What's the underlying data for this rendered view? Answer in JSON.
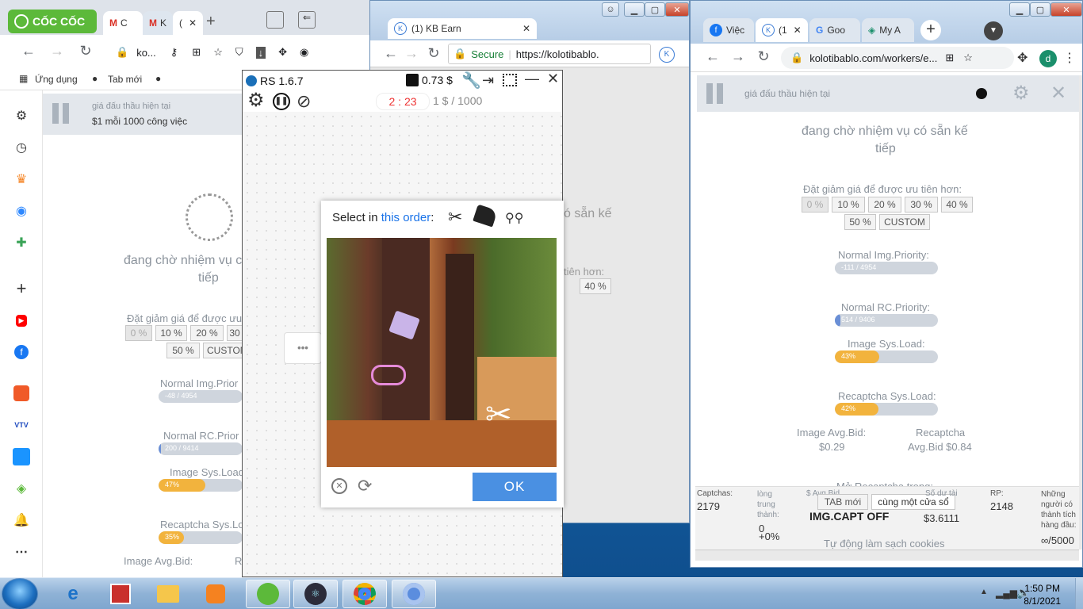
{
  "left_browser": {
    "brand": "CỐC CỐC",
    "tabs": [
      {
        "label": "C"
      },
      {
        "label": "K"
      },
      {
        "label": "("
      }
    ],
    "address": "ko...",
    "bookmarks": [
      {
        "label": "Ứng dụng"
      },
      {
        "label": "Tab mới"
      }
    ],
    "kb": {
      "bid_label": "giá đấu thầu hiện tại",
      "bid_value": "$1 mỗi 1000 công việc",
      "waiting": "đang chờ nhiệm vụ c",
      "waiting2": "tiếp",
      "discount_label": "Đặt giảm giá để được ưu",
      "discounts": [
        "0 %",
        "10 %",
        "20 %",
        "30",
        "50 %",
        "CUSTOM"
      ],
      "bars": [
        {
          "title": "Normal Img.Prior",
          "label": "-48 / 4954",
          "fill": 0.01,
          "color": "#cfd5dd"
        },
        {
          "title": "Normal RC.Prior",
          "label": "200 / 9414",
          "fill": 0.02,
          "color": "#6a8fd6"
        },
        {
          "title": "Image Sys.Load",
          "label": "47%",
          "fill": 0.47,
          "color": "#f2b33d"
        },
        {
          "title": "Recaptcha Sys.Lo",
          "label": "35%",
          "fill": 0.35,
          "color": "#f2b33d"
        }
      ],
      "avg_bid": "Image Avg.Bid:",
      "avg_bid2": "R"
    }
  },
  "middle_browser": {
    "tab": "(1) KB Earn",
    "secure": "Secure",
    "url": "https://kolotibablo.",
    "partial_waiting": "ó sẵn kế",
    "partial_discount": "tiên hơn:",
    "partial_pct": "40 %"
  },
  "right_browser": {
    "tabs": [
      {
        "label": "Việc"
      },
      {
        "label": "(1"
      },
      {
        "label": "Goo"
      },
      {
        "label": "My A"
      }
    ],
    "url": "kolotibablo.com/workers/e...",
    "avatar": "d",
    "kb": {
      "bid_label": "giá đấu thầu hiện tại",
      "waiting": "đang chờ nhiệm vụ có sẵn kế",
      "waiting2": "tiếp",
      "discount_label": "Đặt giảm giá để được ưu tiên hơn:",
      "discounts": [
        "0 %",
        "10 %",
        "20 %",
        "30 %",
        "40 %",
        "50 %",
        "CUSTOM"
      ],
      "bars": [
        {
          "title": "Normal Img.Priority:",
          "label": "-111 / 4954",
          "fill": 0.01,
          "color": "#cfd5dd"
        },
        {
          "title": "Normal RC.Priority:",
          "label": "514 / 9406",
          "fill": 0.05,
          "color": "#6a8fd6"
        },
        {
          "title": "Image Sys.Load:",
          "label": "43%",
          "fill": 0.43,
          "color": "#f2b33d"
        },
        {
          "title": "Recaptcha Sys.Load:",
          "label": "42%",
          "fill": 0.42,
          "color": "#f2b33d"
        }
      ],
      "avg_img_label": "Image Avg.Bid:",
      "avg_img_value": "$0.29",
      "avg_rc_label": "Recaptcha",
      "avg_rc_value": "Avg.Bid $0.84",
      "open_rc": "Mở Recaptcha trong:",
      "tab_new": "TAB mới",
      "same_window": "cùng một cửa sổ",
      "auto_clean": "Tự động làm sạch cookies"
    },
    "stats": {
      "captchas_label": "Captchas:",
      "captchas_value": "2179",
      "loyalty_label": "lòng trung thành:",
      "loyalty_value": "0",
      "loyalty_pct": "+0%",
      "avg_label": "$ Avg.Bid",
      "imgcapt": "IMG.CAPT OFF",
      "balance_label": "Số dư tài",
      "balance_value": "$3.6111",
      "rp_label": "RP:",
      "rp_value": "2148",
      "people_label": "Những người có thành tích hàng đầu:",
      "people_value": "∞/5000"
    }
  },
  "rs_panel": {
    "title": "RS 1.6.7",
    "balance": "0.73 $",
    "timer": "2 : 23",
    "rate": "1 $ / 1000"
  },
  "captcha": {
    "prompt": "Select in ",
    "prompt_link": "this order",
    "prompt_end": ":",
    "ok": "OK"
  },
  "taskbar": {
    "time": "1:50 PM",
    "date": "8/1/2021"
  }
}
